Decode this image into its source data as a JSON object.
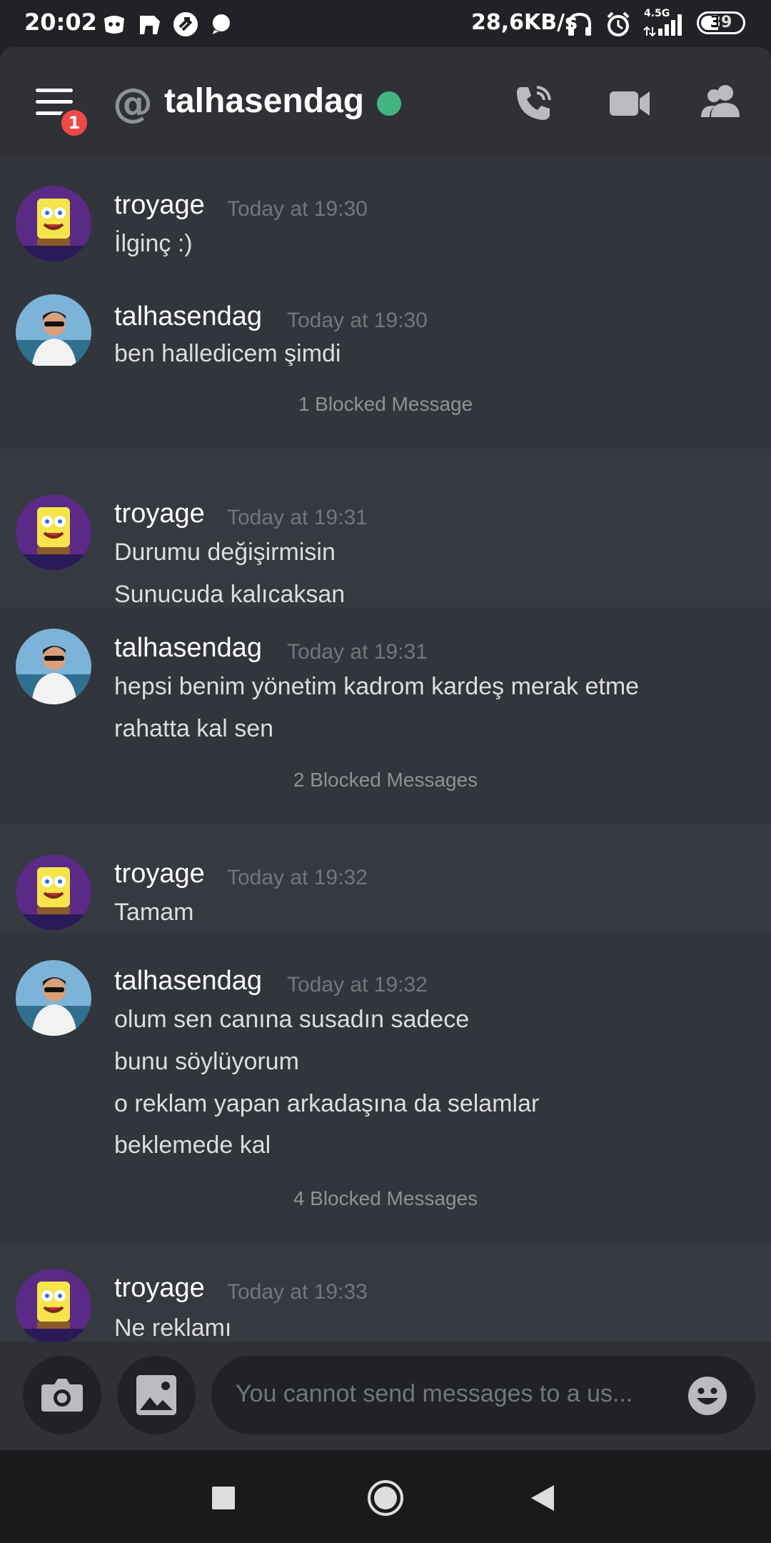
{
  "status_bar": {
    "time": "20:02",
    "network_speed": "28,6KB/s",
    "network_type": "4.5G",
    "battery": "39"
  },
  "header": {
    "unread_badge": "1",
    "channel_name": "talhasendag",
    "online_color": "#43b581",
    "icons": [
      "menu-icon",
      "at-icon",
      "phone-call-icon",
      "video-camera-icon",
      "members-icon"
    ]
  },
  "messages": [
    {
      "author": "troyage",
      "timestamp": "Today at 19:30",
      "lines": [
        "İlginç :)"
      ]
    },
    {
      "author": "talhasendag",
      "timestamp": "Today at 19:30",
      "lines": [
        "ben halledicem şimdi"
      ]
    },
    {
      "blocked": "1 Blocked Message"
    },
    {
      "author": "troyage",
      "timestamp": "Today at 19:31",
      "lines": [
        "Durumu değişirmisin",
        "Sunucuda kalıcaksan"
      ]
    },
    {
      "author": "talhasendag",
      "timestamp": "Today at 19:31",
      "lines": [
        "hepsi benim yönetim kadrom kardeş merak etme",
        "rahatta kal sen"
      ]
    },
    {
      "blocked": "2 Blocked Messages"
    },
    {
      "author": "troyage",
      "timestamp": "Today at 19:32",
      "lines": [
        "Tamam"
      ]
    },
    {
      "author": "talhasendag",
      "timestamp": "Today at 19:32",
      "lines": [
        "olum sen canına susadın sadece",
        "bunu söylüyorum",
        "o reklam yapan arkadaşına da selamlar",
        "beklemede kal"
      ]
    },
    {
      "blocked": "4 Blocked Messages"
    },
    {
      "author": "troyage",
      "timestamp": "Today at 19:33",
      "lines": [
        "Ne reklamı"
      ]
    }
  ],
  "input_bar": {
    "placeholder": "You cannot send messages to a us...",
    "icons": [
      "camera-icon",
      "image-icon",
      "emoji-icon"
    ]
  },
  "nav_bar": {
    "icons": [
      "recents-icon",
      "home-icon",
      "back-icon"
    ]
  },
  "colors": {
    "background": "#36393f",
    "header": "#2f3136",
    "status_bar": "#202225",
    "badge": "#f04747",
    "timestamp": "#72767d"
  }
}
